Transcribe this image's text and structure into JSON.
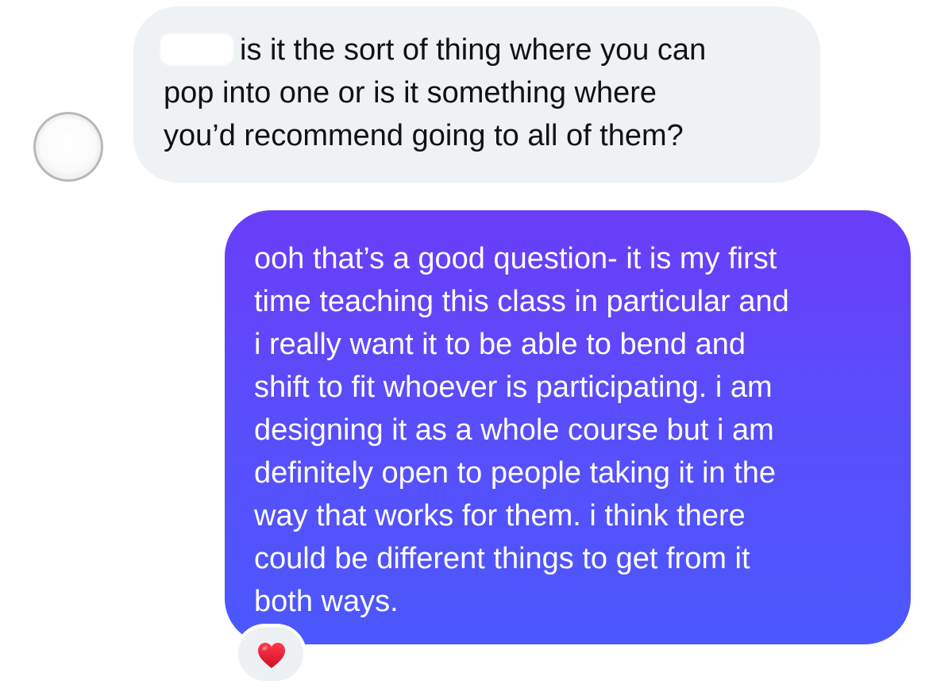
{
  "conversation": {
    "incoming": {
      "text_lines": [
        "is it the sort of thing where you can",
        "pop into one or is it something where",
        "you’d recommend going to all of them?"
      ]
    },
    "outgoing": {
      "text_lines": [
        "ooh that’s a good question- it is my first",
        "time teaching this class in particular and",
        "i really want it to be able to bend and",
        "shift to fit whoever is participating. i am",
        "designing it as a whole course but i am",
        "definitely open to people taking it in the",
        "way that works for them. i think there",
        "could be different things to get from it",
        "both ways."
      ]
    },
    "reaction": {
      "icon": "heart-icon",
      "color": "#e0102a"
    }
  },
  "colors": {
    "incoming_bubble": "#eff2f4",
    "outgoing_gradient_top": "#6a3df9",
    "outgoing_gradient_bottom": "#4b58fd"
  }
}
